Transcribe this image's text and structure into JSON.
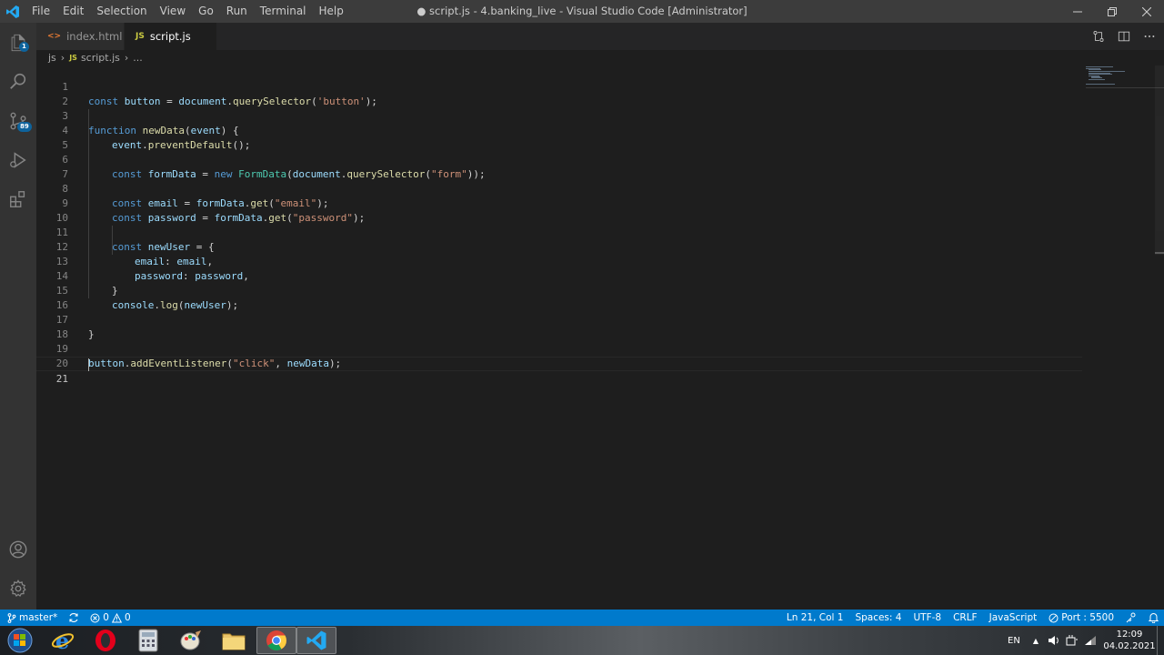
{
  "window": {
    "title": "● script.js - 4.banking_live - Visual Studio Code [Administrator]",
    "menu": [
      "File",
      "Edit",
      "Selection",
      "View",
      "Go",
      "Run",
      "Terminal",
      "Help"
    ]
  },
  "activity_bar": {
    "explorer_badge": "1",
    "scm_badge": "89",
    "items": [
      "files-icon",
      "search-icon",
      "source-control-icon",
      "run-debug-icon",
      "extensions-icon",
      "account-icon",
      "settings-gear-icon"
    ]
  },
  "tabs": [
    {
      "icon_text": "<>",
      "label": "index.html",
      "active": false
    },
    {
      "icon_text": "JS",
      "label": "script.js",
      "active": true,
      "modified": true
    }
  ],
  "breadcrumb": {
    "folder": "js",
    "file_icon": "JS",
    "file": "script.js",
    "more": "..."
  },
  "editor": {
    "current_line": 21,
    "lines": [
      "1",
      "2",
      "3",
      "4",
      "5",
      "6",
      "7",
      "8",
      "9",
      "10",
      "11",
      "12",
      "13",
      "14",
      "15",
      "16",
      "17",
      "18",
      "19",
      "20",
      "21"
    ],
    "code": {
      "l1": {
        "kw": "const",
        "v1": "button",
        "p1": " = ",
        "v2": "document",
        "p2": ".",
        "f1": "querySelector",
        "p3": "(",
        "s1": "'button'",
        "p4": ");"
      },
      "l3": {
        "kw": "function",
        "f1": "newData",
        "p1": "(",
        "v1": "event",
        "p2": ") {"
      },
      "l4": {
        "v1": "event",
        "p1": ".",
        "f1": "preventDefault",
        "p2": "();"
      },
      "l6": {
        "kw": "const",
        "v1": "formData",
        "p1": " = ",
        "kw2": "new",
        "c1": "FormData",
        "p2": "(",
        "v2": "document",
        "p3": ".",
        "f1": "querySelector",
        "p4": "(",
        "s1": "\"form\"",
        "p5": "));"
      },
      "l8": {
        "kw": "const",
        "v1": "email",
        "p1": " = ",
        "v2": "formData",
        "p2": ".",
        "f1": "get",
        "p3": "(",
        "s1": "\"email\"",
        "p4": ");"
      },
      "l9": {
        "kw": "const",
        "v1": "password",
        "p1": " = ",
        "v2": "formData",
        "p2": ".",
        "f1": "get",
        "p3": "(",
        "s1": "\"password\"",
        "p4": ");"
      },
      "l11": {
        "kw": "const",
        "v1": "newUser",
        "p1": " = {"
      },
      "l12": {
        "v1": "email",
        "p1": ": ",
        "v2": "email",
        "p2": ","
      },
      "l13": {
        "v1": "password",
        "p1": ": ",
        "v2": "password",
        "p2": ","
      },
      "l14": {
        "p1": "}"
      },
      "l15": {
        "v1": "console",
        "p1": ".",
        "f1": "log",
        "p2": "(",
        "v2": "newUser",
        "p3": ");"
      },
      "l17": {
        "p1": "}"
      },
      "l19": {
        "v1": "button",
        "p1": ".",
        "f1": "addEventListener",
        "p2": "(",
        "s1": "\"click\"",
        "p3": ", ",
        "v2": "newData",
        "p4": ");"
      }
    }
  },
  "status_bar": {
    "branch": "master*",
    "errors": "0",
    "warnings": "0",
    "cursor": "Ln 21, Col 1",
    "spaces": "Spaces: 4",
    "encoding": "UTF-8",
    "eol": "CRLF",
    "language": "JavaScript",
    "port": "Port : 5500"
  },
  "taskbar": {
    "apps": [
      "windows-start",
      "internet-explorer",
      "opera",
      "calculator",
      "paint",
      "file-explorer",
      "chrome",
      "vscode"
    ],
    "language": "EN",
    "time": "12:09",
    "date": "04.02.2021"
  },
  "colors": {
    "accent": "#007acc",
    "editor_bg": "#1e1e1e",
    "keyword": "#569cd6",
    "variable": "#9cdcfe",
    "function": "#dcdcaa",
    "string": "#ce9178",
    "class": "#4ec9b0"
  }
}
